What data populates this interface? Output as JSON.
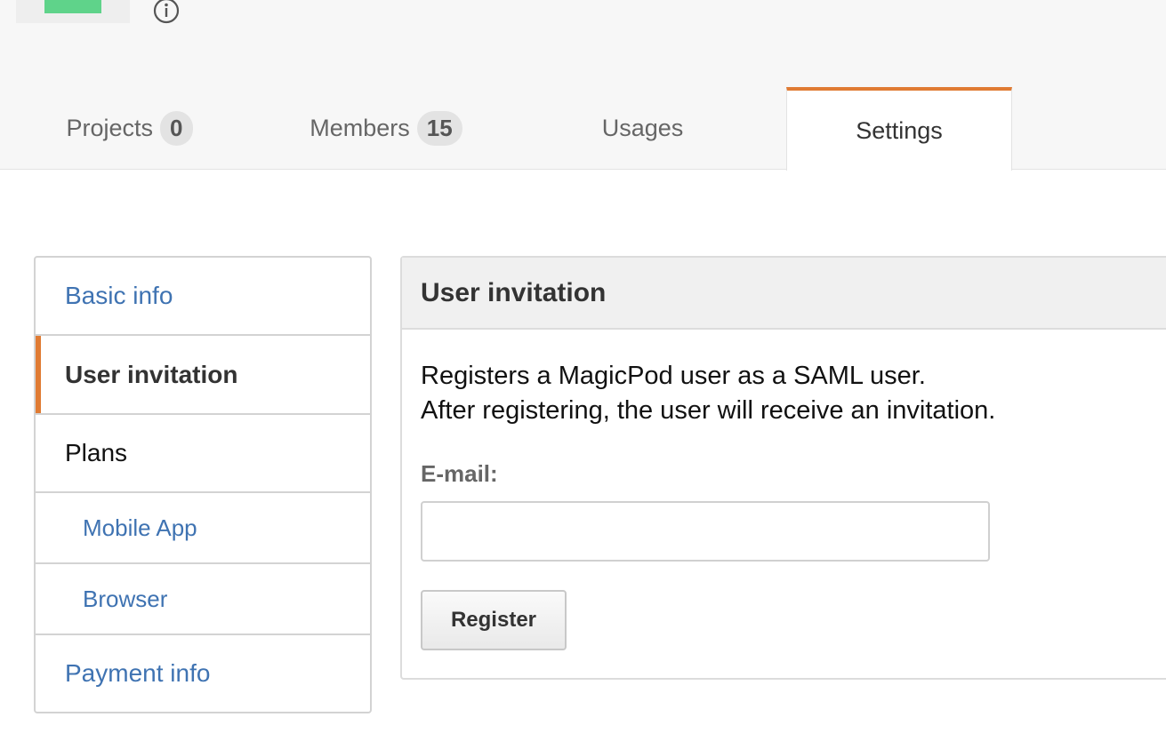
{
  "header": {
    "info_icon": "info-circle-icon",
    "tabs": [
      {
        "label": "Projects",
        "count": "0"
      },
      {
        "label": "Members",
        "count": "15"
      },
      {
        "label": "Usages"
      },
      {
        "label": "Settings",
        "active": true
      }
    ]
  },
  "sidebar": {
    "items": [
      {
        "label": "Basic info"
      },
      {
        "label": "User invitation",
        "active": true
      },
      {
        "label": "Plans"
      },
      {
        "label": "Mobile App"
      },
      {
        "label": "Browser"
      },
      {
        "label": "Payment info"
      }
    ]
  },
  "panel": {
    "title": "User invitation",
    "description_line1": "Registers a MagicPod user as a SAML user.",
    "description_line2": "After registering, the user will receive an invitation.",
    "email_label": "E-mail:",
    "email_value": "",
    "register_label": "Register"
  },
  "colors": {
    "accent": "#e07b33",
    "link": "#3f73b2",
    "logo_green": "#5fd38a"
  }
}
